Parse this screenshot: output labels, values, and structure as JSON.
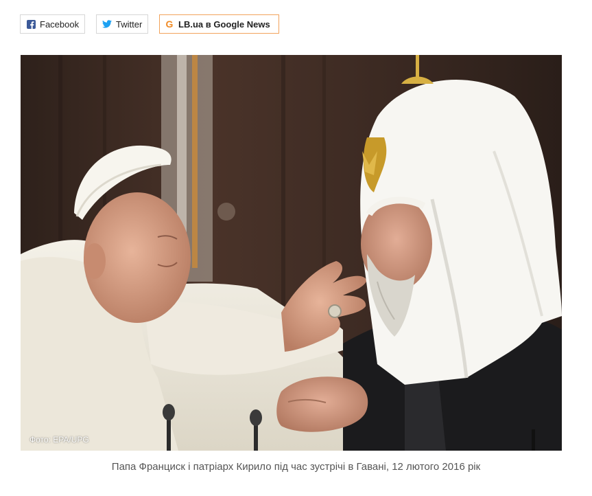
{
  "share": {
    "facebook_label": "Facebook",
    "twitter_label": "Twitter",
    "google_icon": "G",
    "google_label": "LB.ua в Google News"
  },
  "photo": {
    "credit": "Фото: EPA/UPG",
    "caption": "Папа Франциск і патріарх Кирило під час зустрічі в Гавані, 12 лютого 2016 рік"
  },
  "colors": {
    "facebook": "#3b5998",
    "twitter": "#1da1f2",
    "google_accent": "#f08a24",
    "caption_text": "#555555"
  }
}
